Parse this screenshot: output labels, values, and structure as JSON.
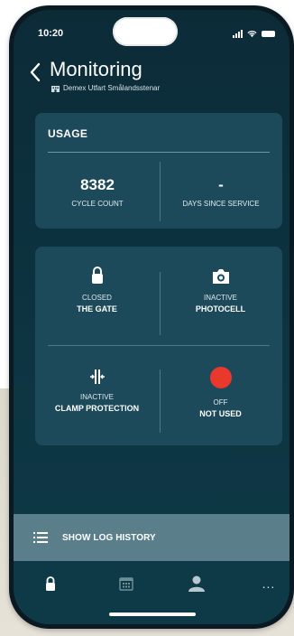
{
  "status_bar": {
    "time": "10:20"
  },
  "header": {
    "title": "Monitoring",
    "subtitle": "Demex Utfart Smålandsstenar"
  },
  "usage": {
    "title": "USAGE",
    "cycle_count": {
      "value": "8382",
      "label": "CYCLE COUNT"
    },
    "days_since_service": {
      "value": "-",
      "label": "DAYS SINCE SERVICE"
    }
  },
  "status_items": [
    {
      "state": "CLOSED",
      "name": "THE GATE",
      "icon": "lock-icon"
    },
    {
      "state": "INACTIVE",
      "name": "PHOTOCELL",
      "icon": "camera-icon"
    },
    {
      "state": "INACTIVE",
      "name": "CLAMP PROTECTION",
      "icon": "clamp-icon"
    },
    {
      "state": "OFF",
      "name": "NOT USED",
      "icon": "red-dot-icon"
    }
  ],
  "log": {
    "label": "SHOW LOG HISTORY"
  },
  "tabs": [
    {
      "icon": "lock-icon"
    },
    {
      "icon": "calendar-icon"
    },
    {
      "icon": "user-icon"
    },
    {
      "icon": "more-icon",
      "label": "..."
    }
  ],
  "colors": {
    "background": "#0b2b37",
    "card": "#1d4a5a",
    "log_bar": "#5a7f8a",
    "indicator_red": "#e8392c"
  }
}
